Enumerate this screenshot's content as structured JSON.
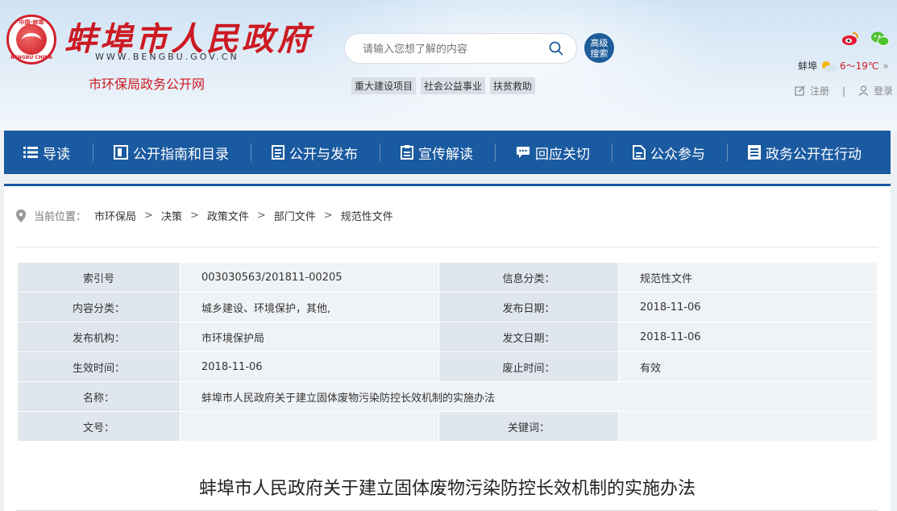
{
  "header": {
    "logo_ring_top": "中国·蚌埠",
    "logo_ring_bottom": "BENGBU CHINA",
    "site_name": "蚌埠市人民政府",
    "site_url": "WWW.BENGBU.GOV.CN",
    "sub_name": "市环保局政务公开网",
    "search_placeholder": "请输入您想了解的内容",
    "adv_search_line1": "高级",
    "adv_search_line2": "搜索",
    "hot_tags": [
      "重大建设项目",
      "社会公益事业",
      "扶贫救助"
    ],
    "weather_city": "蚌埠",
    "weather_temp": "6～19℃",
    "register": "注册",
    "login": "登录",
    "divider": "|"
  },
  "nav": {
    "items": [
      "导读",
      "公开指南和目录",
      "公开与发布",
      "宣传解读",
      "回应关切",
      "公众参与",
      "政务公开在行动"
    ]
  },
  "breadcrumb": {
    "label": "当前位置：",
    "items": [
      "市环保局",
      "决策",
      "政策文件",
      "部门文件",
      "规范性文件"
    ],
    "sep": ">"
  },
  "meta": {
    "index_label": "索引号",
    "index_value": "003030563/201811-00205",
    "info_cat_label": "信息分类：",
    "info_cat_value": "规范性文件",
    "content_cat_label": "内容分类：",
    "content_cat_value": "城乡建设、环境保护，其他,",
    "pub_date_label": "发布日期：",
    "pub_date_value": "2018-11-06",
    "org_label": "发布机构：",
    "org_value": "市环境保护局",
    "doc_date_label": "发文日期：",
    "doc_date_value": "2018-11-06",
    "effective_label": "生效时间：",
    "effective_value": "2018-11-06",
    "abolish_label": "废止时间：",
    "abolish_value": "有效",
    "name_label": "名称：",
    "name_value": "蚌埠市人民政府关于建立固体废物污染防控长效机制的实施办法",
    "docno_label": "文号：",
    "docno_value": "",
    "keywords_label": "关键词：",
    "keywords_value": ""
  },
  "doc_title": "蚌埠市人民政府关于建立固体废物污染防控长效机制的实施办法",
  "colors": {
    "brand_red": "#cc1a22",
    "nav_blue": "#1a5aa0"
  }
}
